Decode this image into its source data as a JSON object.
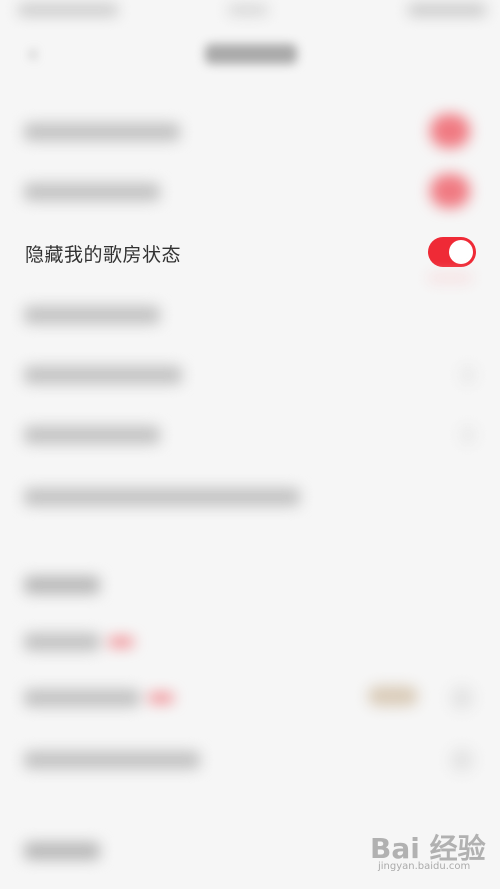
{
  "settings": {
    "hide_room_status_label": "隐藏我的歌房状态",
    "hide_room_status_on": true
  },
  "colors": {
    "switch_on": "#ef2a36",
    "background": "#f6f6f6"
  },
  "watermark": {
    "brand": "Bai 经验",
    "site": "jingyan.baidu.com"
  }
}
